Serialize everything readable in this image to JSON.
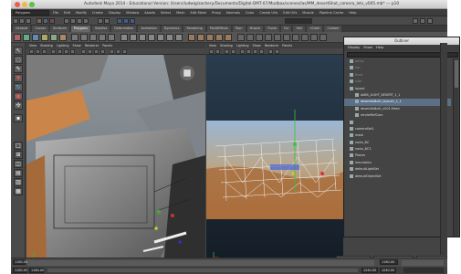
{
  "window": {
    "title": "Autodesk Maya 2014 - Educational Version: /Users/ludwig/zachery/Documents/Digital-DMT-07/Mudbox/scenes/las/MM_desertShot_camera_lets_v005.mb* --- p10"
  },
  "menu_bar": {
    "mode": "Polygons",
    "items": [
      "File",
      "Edit",
      "Modify",
      "Create",
      "Display",
      "Window",
      "Assets",
      "Select",
      "Mesh",
      "Edit Mesh",
      "Proxy",
      "Normals",
      "Color",
      "Create UVs",
      "Edit UVs",
      "Muscle",
      "Pipeline Cache",
      "Help"
    ]
  },
  "shelf": {
    "tabs": [
      "General",
      "Curves",
      "Surfaces",
      "Polygons",
      "Subdivs",
      "Deformation",
      "Animation",
      "Dynamics",
      "Rendering",
      "PaintEffects",
      "Toon",
      "Muscle",
      "Fluids",
      "Fur",
      "Hair",
      "nCloth",
      "Custom"
    ],
    "active_tab": "Polygons"
  },
  "left_viewport": {
    "menus": [
      "View",
      "Shading",
      "Lighting",
      "Show",
      "Renderer",
      "Panels"
    ]
  },
  "right_viewport": {
    "menus": [
      "View",
      "Shading",
      "Lighting",
      "Show",
      "Renderer",
      "Panels"
    ]
  },
  "outliner": {
    "title": "Outliner",
    "menus": [
      "Display",
      "Show",
      "Help"
    ],
    "items": [
      {
        "label": "persp",
        "state": "dim"
      },
      {
        "label": "top",
        "state": "dim"
      },
      {
        "label": "front",
        "state": "dim"
      },
      {
        "label": "side",
        "state": "dim"
      },
      {
        "label": "layout",
        "state": "normal"
      },
      {
        "label": "AdBS_LIGHT_DESERT_1_1",
        "state": "normal"
      },
      {
        "label": "desertAsBuilt_layout1_1_1",
        "state": "selected"
      },
      {
        "label": "desertAsBuilt_v001:Mesh",
        "state": "normal"
      },
      {
        "label": "renderRefCam",
        "state": "normal"
      },
      {
        "label": "",
        "state": "normal"
      },
      {
        "label": "cameraSet1",
        "state": "normal"
      },
      {
        "label": "mask",
        "state": "normal"
      },
      {
        "label": "rocks_BC",
        "state": "normal"
      },
      {
        "label": "rocks_BC1",
        "state": "normal"
      },
      {
        "label": "Planes",
        "state": "normal"
      },
      {
        "label": "mountains",
        "state": "normal"
      },
      {
        "label": "defaultLightSet",
        "state": "normal"
      },
      {
        "label": "defaultObjectSet",
        "state": "normal"
      }
    ]
  },
  "bottom_buttons": [
    "Select",
    "Load Attributes",
    "Copy Tab"
  ],
  "timeline": {
    "start": "1180.00",
    "end": "1180.00",
    "range_start": "1180.00",
    "current": "1180.00",
    "range_end": "1240.00",
    "end_time": "1240.00"
  },
  "colors": {
    "accent_selected": "#5b6f86",
    "maya_bg": "#444444",
    "viewport_grid_red": "#d03030",
    "viewport_grid_green": "#30b040"
  },
  "icons": {
    "toolbox": [
      "select-icon",
      "lasso-icon",
      "paint-select-icon",
      "move-icon",
      "rotate-icon",
      "scale-icon",
      "universal-manipulator-icon",
      "last-tool-icon"
    ],
    "view_cube": "view-cube-icon"
  }
}
